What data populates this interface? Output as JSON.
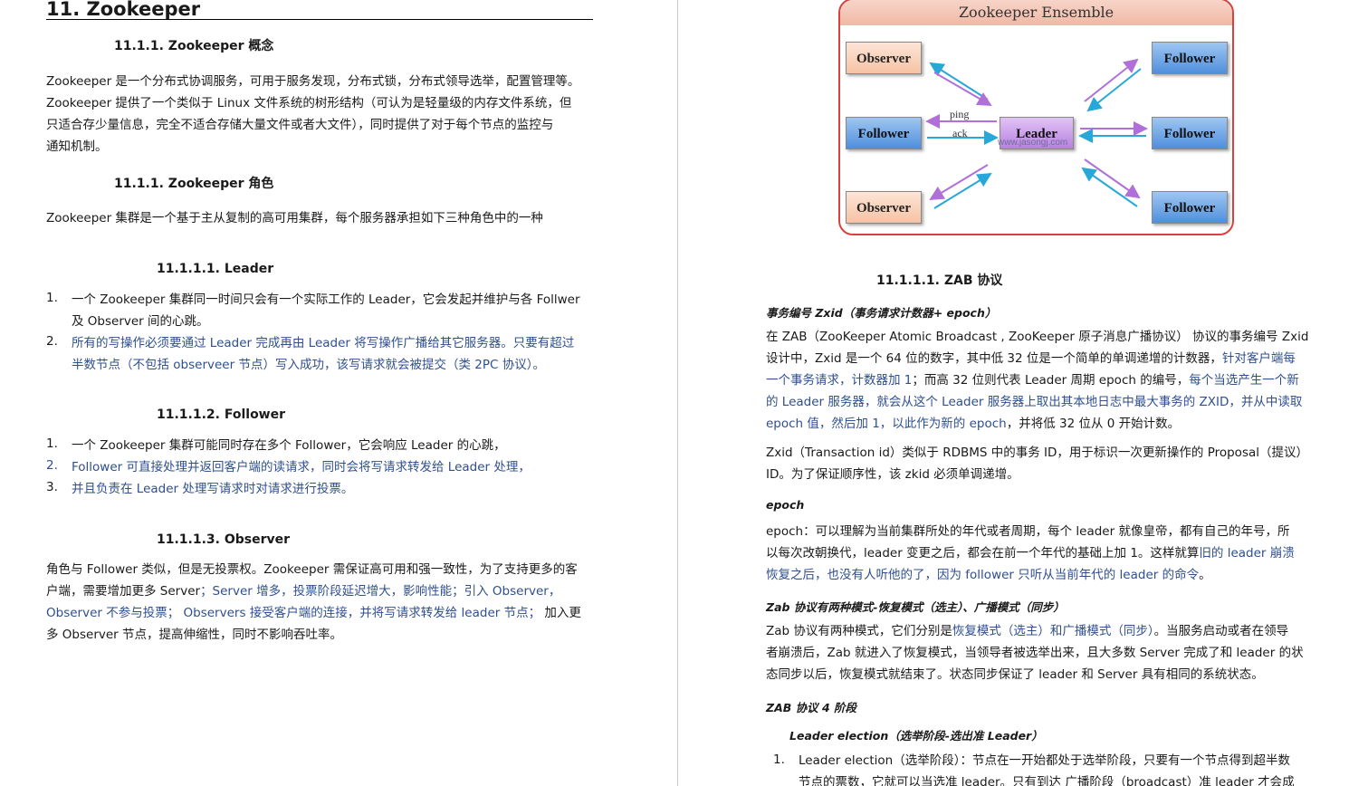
{
  "left": {
    "h1": "11.   Zookeeper",
    "sec_concept": "11.1.1.    Zookeeper 概念",
    "concept_lines": [
      "Zookeeper 是一个分布式协调服务，可用于服务发现，分布式锁，分布式领导选举，配置管理等。",
      "Zookeeper 提供了一个类似于 Linux 文件系统的树形结构（可认为是轻量级的内存文件系统，但",
      "只适合存少量信息，完全不适合存储大量文件或者大文件），同时提供了对于每个节点的监控与",
      "通知机制。"
    ],
    "sec_role": "11.1.1.    Zookeeper 角色",
    "role_intro": "Zookeeper 集群是一个基于主从复制的高可用集群，每个服务器承担如下三种角色中的一种",
    "leader_h": "11.1.1.1.   Leader",
    "leader_items": [
      {
        "n": "1.",
        "l1": "一个 Zookeeper 集群同一时间只会有一个实际工作的 Leader，它会发起并维护与各 Follwer",
        "l2": "及 Observer 间的心跳。"
      },
      {
        "n": "2.",
        "l1": "所有的写操作必须要通过 Leader 完成再由 Leader 将写操作广播给其它服务器。只要有超过",
        "l2": "半数节点（不包括 observeer 节点）写入成功，该写请求就会被提交（类 2PC 协议）。"
      }
    ],
    "follower_h": "11.1.1.2.   Follower",
    "follower_items": [
      {
        "n": "1.",
        "t": "一个 Zookeeper 集群可能同时存在多个 Follower，它会响应 Leader 的心跳，"
      },
      {
        "n": "2.",
        "t": "Follower 可直接处理并返回客户端的读请求，同时会将写请求转发给 Leader 处理，"
      },
      {
        "n": "3.",
        "t": "并且负责在 Leader 处理写请求时对请求进行投票。"
      }
    ],
    "observer_h": "11.1.1.3.   Observer",
    "observer_l1": "角色与 Follower 类似，但是无投票权。Zookeeper 需保证高可用和强一致性，为了支持更多的客",
    "observer_l2a": "户端，需要增加更多 Server",
    "observer_l2b": "；Server 增多，投票阶段延迟增大，影响性能；引入 Observer，",
    "observer_l3a": "Observer 不参与投票；  Observers 接受客户端的连接，并将写请求转发给 leader 节点；",
    "observer_l3b": "  加入更",
    "observer_l4": "多 Observer 节点，提高伸缩性，同时不影响吞吐率。"
  },
  "diagram": {
    "title": "Zookeeper Ensemble",
    "observer_label": "Observer",
    "follower_label": "Follower",
    "leader_label": "Leader",
    "ping": "ping",
    "ack": "ack",
    "watermark": "www.jasongj.com",
    "arrow_purple": "#b070d8",
    "arrow_cyan": "#27a8d8"
  },
  "right": {
    "zab_h": "11.1.1.1.   ZAB 协议",
    "zxid_label": "事务编号 Zxid（事务请求计数器+ epoch）",
    "zxid_l1": "在 ZAB（ZooKeeper Atomic Broadcast , ZooKeeper 原子消息广播协议） 协议的事务编号 Zxid",
    "zxid_l2a": "设计中，Zxid 是一个 64 位的数字，其中低 32 位是一个简单的单调递增的计数器，",
    "zxid_l2b": "针对客户端每",
    "zxid_l3a": "一个事务请求，计数器加 1",
    "zxid_l3b": "；而高 32 位则代表 Leader 周期 epoch 的编号，",
    "zxid_l3c": "每个当选产生一个新",
    "zxid_l4": "的 Leader 服务器，就会从这个 Leader 服务器上取出其本地日志中最大事务的 ZXID，并从中读取",
    "zxid_l5a": "epoch 值，然后加 1，以此作为新的 epoch",
    "zxid_l5b": "，并将低 32 位从 0 开始计数。",
    "zxid2_l1": "Zxid（Transaction id）类似于 RDBMS 中的事务 ID，用于标识一次更新操作的 Proposal（提议）",
    "zxid2_l2": "ID。为了保证顺序性，该 zkid 必须单调递增。",
    "epoch_label": "epoch",
    "epoch_l1": "epoch：可以理解为当前集群所处的年代或者周期，每个 leader 就像皇帝，都有自己的年号，所",
    "epoch_l2a": "以每次改朝换代，leader 变更之后，都会在前一个年代的基础上加 1。这样就算",
    "epoch_l2b": "旧的 leader 崩溃",
    "epoch_l3a": "恢复之后，也没有人听他的了，因为 follower 只听从当前年代的 leader 的命令",
    "epoch_l3b": "。",
    "mode_label": "Zab 协议有两种模式-恢复模式（选主）、广播模式（同步）",
    "mode_l1a": "Zab 协议有两种模式，它们分别是",
    "mode_l1b": "恢复模式（选主）和广播模式（同步）",
    "mode_l1c": "。当服务启动或者在领导",
    "mode_l2": "者崩溃后，Zab 就进入了恢复模式，当领导者被选举出来，且大多数 Server 完成了和 leader 的状",
    "mode_l3": "态同步以后，恢复模式就结束了。状态同步保证了 leader 和 Server 具有相同的系统状态。",
    "stage_label": "ZAB 协议 4 阶段",
    "elect_label": "Leader election（选举阶段-选出准 Leader）",
    "elect_n": "1.",
    "elect_l1": "Leader election（选举阶段）：节点在一开始都处于选举阶段，只要有一个节点得到超半数",
    "elect_l2": "节点的票数，它就可以当选准 leader。只有到达 广播阶段（broadcast）准 leader 才会成"
  }
}
